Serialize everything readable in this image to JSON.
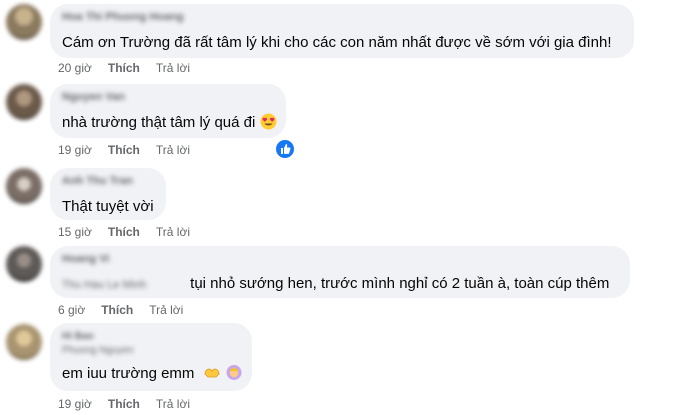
{
  "comments": [
    {
      "author": "Hoa Thi Phuong Hoang",
      "text": "Cám ơn Trường đã rất tâm lý khi cho các con năm nhất được về sớm với gia đình!",
      "time": "20 giờ",
      "like": "Thích",
      "reply": "Trả lời",
      "avatar_color": "#8a7a5e"
    },
    {
      "author": "Nguyen Van",
      "text": "nhà trường thật tâm lý quá đi",
      "emoji": "heart-eyes-face-icon",
      "time": "19 giờ",
      "like": "Thích",
      "reply": "Trả lời",
      "reaction": "like-reaction-icon",
      "avatar_color": "#6b5a4a"
    },
    {
      "author": "Anh Thu Tran",
      "text": "Thật tuyệt vời",
      "time": "15 giờ",
      "like": "Thích",
      "reply": "Trả lời",
      "avatar_color": "#7a6e66"
    },
    {
      "author": "Hoang Vi",
      "mention": "Thu Hau Le Minh",
      "text": "tụi nhỏ sướng hen, trước mình nghỉ có 2 tuần à, toàn cúp thêm",
      "time": "6 giờ",
      "like": "Thích",
      "reply": "Trả lời",
      "avatar_color": "#5e5a58"
    },
    {
      "author": "Hi Bao",
      "author2": "Phuong Nguyen",
      "text": "em iuu trường emm",
      "emoji": "heart-hands-icon",
      "emoji2": "person-with-crown-icon",
      "time": "19 giờ",
      "like": "Thích",
      "reply": "Trả lời",
      "avatar_color": "#a89470"
    }
  ],
  "colors": {
    "bubble": "#f0f2f5",
    "meta": "#65676b",
    "like_blue": "#1877f2"
  }
}
